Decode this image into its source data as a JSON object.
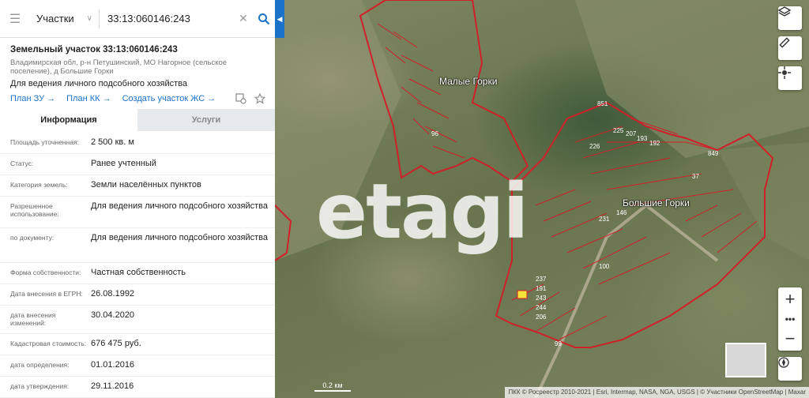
{
  "search": {
    "category": "Участки",
    "query": "33:13:060146:243"
  },
  "parcel": {
    "title": "Земельный участок 33:13:060146:243",
    "address": "Владимирская обл, р-н Петушинский, МО Нагорное (сельское поселение), д Большие Горки",
    "use": "Для ведения личного подсобного хозяйства",
    "links": [
      "План ЗУ →",
      "План КК →",
      "Создать участок ЖС →"
    ]
  },
  "tabs": {
    "info": "Информация",
    "services": "Услуги"
  },
  "rows": [
    {
      "label": "Площадь уточненная:",
      "value": "2 500 кв. м"
    },
    {
      "label": "Статус:",
      "value": "Ранее учтенный"
    },
    {
      "label": "Категория земель:",
      "value": "Земли населённых пунктов"
    },
    {
      "label": "Разрешенное использование:",
      "value": "Для ведения личного подсобного хозяйства"
    },
    {
      "label": "по документу:",
      "value": "Для ведения личного подсобного хозяйства"
    },
    {
      "label": "Форма собственности:",
      "value": "Частная собственность"
    },
    {
      "label": "Дата внесения в ЕГРН:",
      "value": "26.08.1992"
    },
    {
      "label": "дата внесения изменений:",
      "value": "30.04.2020"
    },
    {
      "label": "Кадастровая стоимость:",
      "value": "676 475 руб."
    },
    {
      "label": "дата определения:",
      "value": "01.01.2016"
    },
    {
      "label": "дата утверждения:",
      "value": "29.11.2016"
    }
  ],
  "map": {
    "watermark": "etagi",
    "places": {
      "small": "Малые Горки",
      "big": "Большие Горки"
    },
    "scale": "0.2 км",
    "attribution": "ПКК © Росреестр 2010-2021 | Esri, Intermap, NASA, NGA, USGS | © Участники OpenStreetMap | Maxar",
    "parcel_labels": [
      "851",
      "849",
      "225",
      "207",
      "193",
      "192",
      "226",
      "231",
      "146",
      "100",
      "96",
      "99",
      "237",
      "191",
      "243",
      "244",
      "206",
      "37"
    ]
  },
  "colors": {
    "accent": "#1a73c9",
    "boundary": "#d0202a",
    "highlight": "#f5e23a"
  }
}
